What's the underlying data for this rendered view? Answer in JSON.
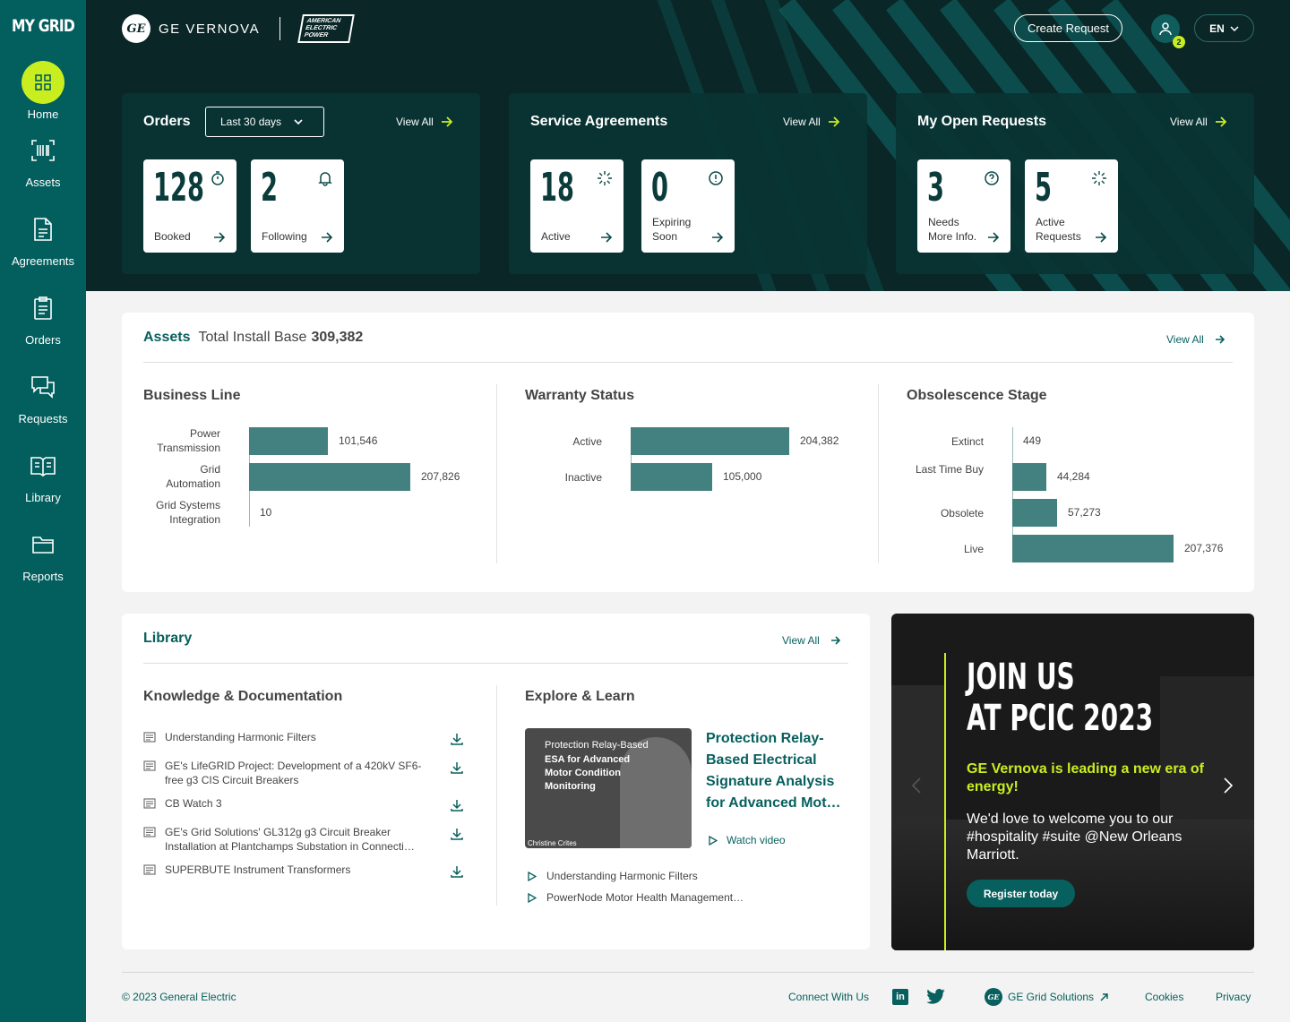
{
  "sidebar": {
    "logo": "MY GRID",
    "items": [
      {
        "label": "Home",
        "icon": "grid-icon"
      },
      {
        "label": "Assets",
        "icon": "barcode-icon"
      },
      {
        "label": "Agreements",
        "icon": "document-icon"
      },
      {
        "label": "Orders",
        "icon": "clipboard-icon"
      },
      {
        "label": "Requests",
        "icon": "chat-icon"
      },
      {
        "label": "Library",
        "icon": "book-icon"
      },
      {
        "label": "Reports",
        "icon": "folder-icon"
      }
    ]
  },
  "header": {
    "brand": "GE VERNOVA",
    "ge_logo": "GE",
    "partner_logo": "AMERICAN ELECTRIC POWER",
    "create_request": "Create Request",
    "notification_count": "2",
    "language": "EN"
  },
  "orders": {
    "title": "Orders",
    "range": "Last 30 days",
    "view_all": "View All",
    "stats": [
      {
        "value": "128",
        "label": "Booked",
        "icon": "stopwatch-icon"
      },
      {
        "value": "2",
        "label": "Following",
        "icon": "bell-icon"
      }
    ]
  },
  "service_agreements": {
    "title": "Service Agreements",
    "view_all": "View All",
    "stats": [
      {
        "value": "18",
        "label": "Active",
        "icon": "loading-icon"
      },
      {
        "value": "0",
        "label": "Expiring Soon",
        "icon": "alert-icon"
      }
    ]
  },
  "open_requests": {
    "title": "My Open Requests",
    "view_all": "View All",
    "stats": [
      {
        "value": "3",
        "label": "Needs More Info.",
        "icon": "help-icon"
      },
      {
        "value": "5",
        "label": "Active Requests",
        "icon": "loading-icon"
      }
    ]
  },
  "assets": {
    "title": "Assets",
    "subtitle": "Total Install Base",
    "total": "309,382",
    "view_all": "View All"
  },
  "chart_data": [
    {
      "type": "bar",
      "title": "Business Line",
      "categories": [
        "Power Transmission",
        "Grid Automation",
        "Grid Systems Integration"
      ],
      "values": [
        101546,
        207826,
        10
      ],
      "labels": [
        "101,546",
        "207,826",
        "10"
      ],
      "color": "#438180"
    },
    {
      "type": "bar",
      "title": "Warranty Status",
      "categories": [
        "Active",
        "Inactive"
      ],
      "values": [
        204382,
        105000
      ],
      "labels": [
        "204,382",
        "105,000"
      ],
      "color": "#438180"
    },
    {
      "type": "bar",
      "title": "Obsolescence Stage",
      "categories": [
        "Extinct",
        "Last Time Buy",
        "Obsolete",
        "Live"
      ],
      "values": [
        449,
        44284,
        57273,
        207376
      ],
      "labels": [
        "449",
        "44,284",
        "57,273",
        "207,376"
      ],
      "color": "#438180"
    }
  ],
  "library": {
    "title": "Library",
    "view_all": "View All",
    "knowledge_title": "Knowledge & Documentation",
    "docs": [
      "Understanding Harmonic Filters",
      "GE's LifeGRID Project: Development of a 420kV SF6-free g3 CIS Circuit Breakers",
      "CB Watch 3",
      "GE's Grid Solutions' GL312g g3 Circuit Breaker Installation at Plantchamps Substation in Connecti…",
      "SUPERBUTE Instrument Transformers"
    ],
    "explore_title": "Explore & Learn",
    "video": {
      "thumb_line1": "Protection Relay-Based",
      "thumb_line2": "ESA for Advanced Motor Condition Monitoring",
      "thumb_person": "Christine Crites",
      "title": "Protection Relay-Based Electrical Signature Analysis for Advanced Mot…",
      "watch": "Watch video"
    },
    "more_videos": [
      "Understanding Harmonic Filters",
      "PowerNode Motor Health Management…"
    ]
  },
  "promo": {
    "title_line1": "JOIN US",
    "title_line2": "AT PCIC 2023",
    "headline": "GE Vernova is leading a new era of energy!",
    "body": "We'd love to welcome you to our #hospitality #suite @New Orleans Marriott.",
    "cta": "Register today"
  },
  "footer": {
    "copyright": "© 2023 General Electric",
    "connect": "Connect With Us",
    "grid_solutions": "GE Grid Solutions",
    "cookies": "Cookies",
    "privacy": "Privacy"
  }
}
